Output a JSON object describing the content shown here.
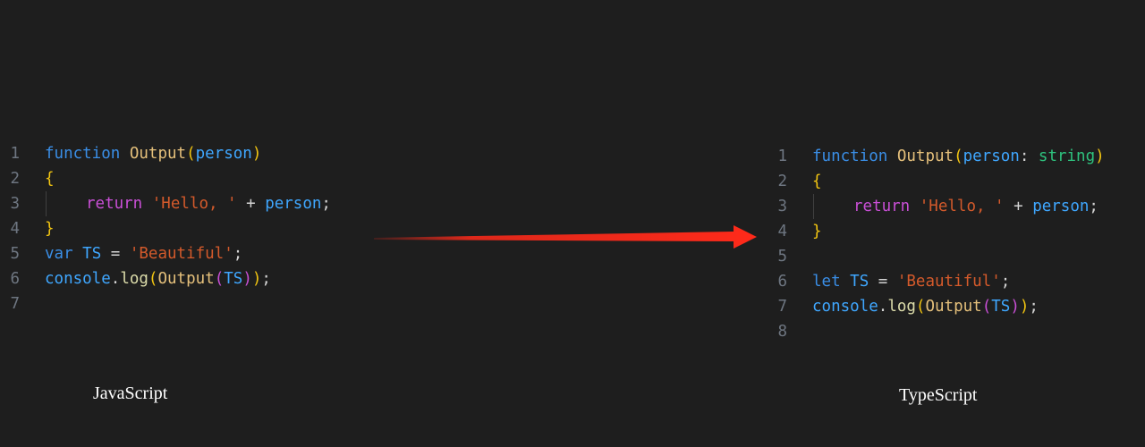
{
  "javascript": {
    "caption": "JavaScript",
    "lines": [
      {
        "number": "1",
        "tokens": [
          {
            "text": "function",
            "role": "kw-blue"
          },
          {
            "text": " ",
            "role": "plain"
          },
          {
            "text": "Output",
            "role": "fn"
          },
          {
            "text": "(",
            "role": "brace"
          },
          {
            "text": "person",
            "role": "param"
          },
          {
            "text": ")",
            "role": "brace"
          }
        ]
      },
      {
        "number": "2",
        "tokens": [
          {
            "text": "{",
            "role": "brace"
          }
        ]
      },
      {
        "number": "3",
        "indent": true,
        "tokens": [
          {
            "text": "return",
            "role": "kw-pink"
          },
          {
            "text": " ",
            "role": "plain"
          },
          {
            "text": "'Hello, '",
            "role": "str"
          },
          {
            "text": " + ",
            "role": "op"
          },
          {
            "text": "person",
            "role": "ident"
          },
          {
            "text": ";",
            "role": "plain"
          }
        ]
      },
      {
        "number": "4",
        "tokens": [
          {
            "text": "}",
            "role": "brace"
          }
        ]
      },
      {
        "number": "5",
        "tokens": [
          {
            "text": "var",
            "role": "kw-blue"
          },
          {
            "text": " ",
            "role": "plain"
          },
          {
            "text": "TS",
            "role": "ident"
          },
          {
            "text": " = ",
            "role": "op"
          },
          {
            "text": "'Beautiful'",
            "role": "str"
          },
          {
            "text": ";",
            "role": "plain"
          }
        ]
      },
      {
        "number": "6",
        "tokens": [
          {
            "text": "console",
            "role": "ident"
          },
          {
            "text": ".",
            "role": "plain"
          },
          {
            "text": "log",
            "role": "method"
          },
          {
            "text": "(",
            "role": "brace"
          },
          {
            "text": "Output",
            "role": "fn"
          },
          {
            "text": "(",
            "role": "paren-purple"
          },
          {
            "text": "TS",
            "role": "ident"
          },
          {
            "text": ")",
            "role": "paren-purple"
          },
          {
            "text": ")",
            "role": "brace"
          },
          {
            "text": ";",
            "role": "plain"
          }
        ]
      },
      {
        "number": "7",
        "tokens": []
      }
    ]
  },
  "typescript": {
    "caption": "TypeScript",
    "lines": [
      {
        "number": "1",
        "tokens": [
          {
            "text": "function",
            "role": "kw-blue"
          },
          {
            "text": " ",
            "role": "plain"
          },
          {
            "text": "Output",
            "role": "fn"
          },
          {
            "text": "(",
            "role": "brace"
          },
          {
            "text": "person",
            "role": "param"
          },
          {
            "text": ": ",
            "role": "plain"
          },
          {
            "text": "string",
            "role": "type"
          },
          {
            "text": ")",
            "role": "brace"
          }
        ]
      },
      {
        "number": "2",
        "tokens": [
          {
            "text": "{",
            "role": "brace"
          }
        ]
      },
      {
        "number": "3",
        "indent": true,
        "tokens": [
          {
            "text": "return",
            "role": "kw-pink"
          },
          {
            "text": " ",
            "role": "plain"
          },
          {
            "text": "'Hello, '",
            "role": "str"
          },
          {
            "text": " + ",
            "role": "op"
          },
          {
            "text": "person",
            "role": "ident"
          },
          {
            "text": ";",
            "role": "plain"
          }
        ]
      },
      {
        "number": "4",
        "tokens": [
          {
            "text": "}",
            "role": "brace"
          }
        ]
      },
      {
        "number": "5",
        "tokens": []
      },
      {
        "number": "6",
        "tokens": [
          {
            "text": "let",
            "role": "kw-blue"
          },
          {
            "text": " ",
            "role": "plain"
          },
          {
            "text": "TS",
            "role": "ident"
          },
          {
            "text": " = ",
            "role": "op"
          },
          {
            "text": "'Beautiful'",
            "role": "str"
          },
          {
            "text": ";",
            "role": "plain"
          }
        ]
      },
      {
        "number": "7",
        "tokens": [
          {
            "text": "console",
            "role": "ident"
          },
          {
            "text": ".",
            "role": "plain"
          },
          {
            "text": "log",
            "role": "method"
          },
          {
            "text": "(",
            "role": "brace"
          },
          {
            "text": "Output",
            "role": "fn"
          },
          {
            "text": "(",
            "role": "paren-purple"
          },
          {
            "text": "TS",
            "role": "ident"
          },
          {
            "text": ")",
            "role": "paren-purple"
          },
          {
            "text": ")",
            "role": "brace"
          },
          {
            "text": ";",
            "role": "plain"
          }
        ]
      },
      {
        "number": "8",
        "tokens": []
      }
    ]
  },
  "arrow": {
    "color": "#ff2a1a",
    "icon": "arrow-right-icon"
  },
  "colors": {
    "background": "#1e1e1e",
    "line_number": "#6e7681",
    "caption": "#ffffff"
  }
}
